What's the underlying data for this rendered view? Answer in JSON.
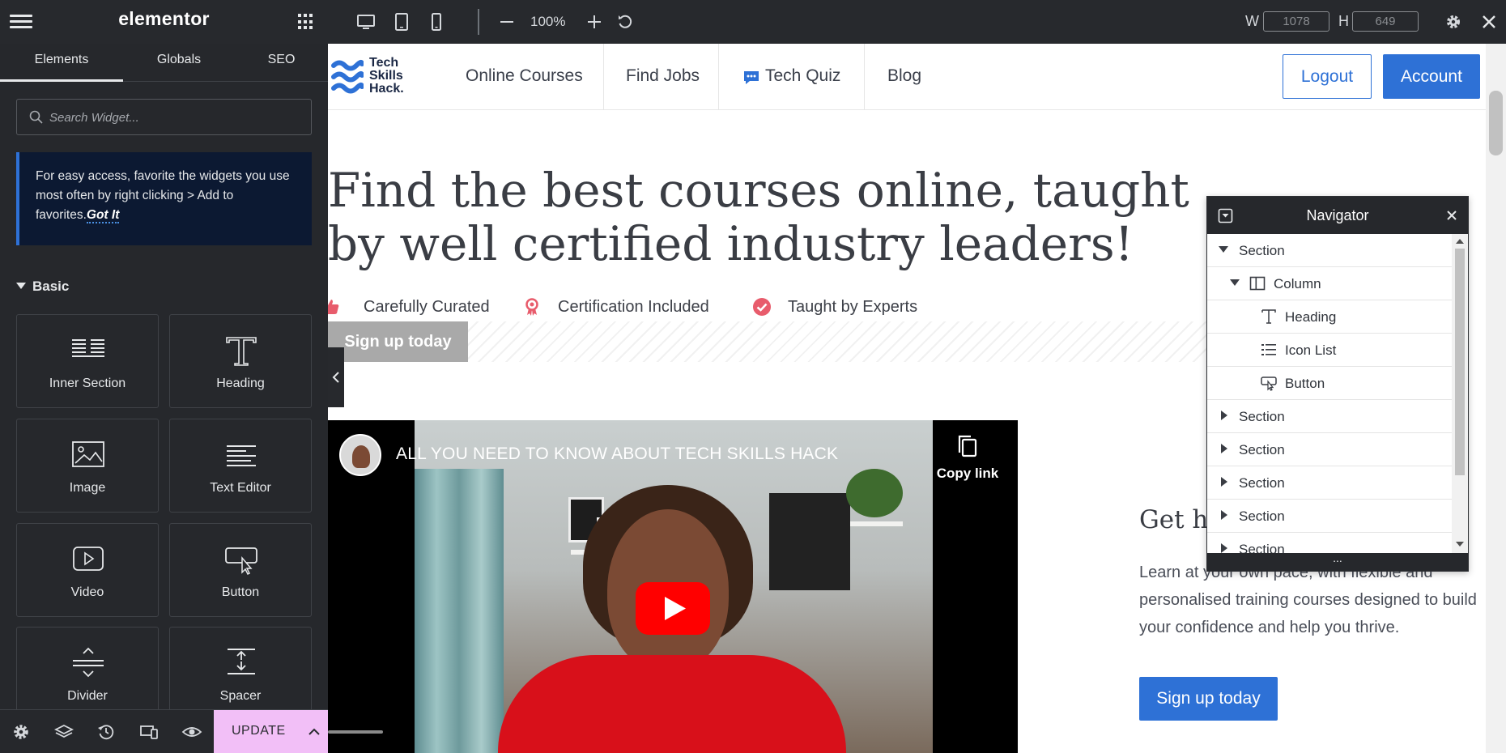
{
  "topbar": {
    "logo": "elementor",
    "zoom": "100%",
    "width_label": "W",
    "width_value": "1078",
    "height_label": "H",
    "height_value": "649"
  },
  "panel": {
    "tabs": [
      {
        "label": "Elements",
        "active": true
      },
      {
        "label": "Globals",
        "active": false
      },
      {
        "label": "SEO",
        "active": false
      }
    ],
    "search": {
      "placeholder": "Search Widget..."
    },
    "notice": {
      "text": "For easy access, favorite the widgets you use most often by right clicking > Add to favorites.",
      "link": "Got It"
    },
    "category": "Basic",
    "widgets": [
      {
        "label": "Inner Section",
        "icon": "inner-section-icon"
      },
      {
        "label": "Heading",
        "icon": "heading-icon"
      },
      {
        "label": "Image",
        "icon": "image-icon"
      },
      {
        "label": "Text Editor",
        "icon": "text-editor-icon"
      },
      {
        "label": "Video",
        "icon": "video-icon"
      },
      {
        "label": "Button",
        "icon": "button-icon"
      },
      {
        "label": "Divider",
        "icon": "divider-icon"
      },
      {
        "label": "Spacer",
        "icon": "spacer-icon"
      }
    ],
    "footer": {
      "update_label": "UPDATE"
    }
  },
  "site": {
    "logo_lines": [
      "Tech",
      "Skills",
      "Hack."
    ],
    "nav": [
      "Online Courses",
      "Find Jobs",
      "Tech Quiz",
      "Blog"
    ],
    "logout": "Logout",
    "account": "Account",
    "hero_title": "Find the best courses online, taught by well certified industry leaders!",
    "features": [
      "Carefully Curated",
      "Certification Included",
      "Taught by Experts"
    ],
    "signup": "Sign up today",
    "video": {
      "title": "ALL YOU NEED TO KNOW ABOUT TECH SKILLS HACK",
      "copy_link": "Copy link"
    },
    "side_heading": "Get hi",
    "side_text": "Learn at your own pace, with flexible and personalised training courses designed to build your confidence and help you thrive.",
    "side_signup": "Sign up today"
  },
  "navigator": {
    "title": "Navigator",
    "items": [
      {
        "label": "Section",
        "level": 0,
        "expanded": true
      },
      {
        "label": "Column",
        "level": 1,
        "expanded": true
      },
      {
        "label": "Heading",
        "level": 2
      },
      {
        "label": "Icon List",
        "level": 2
      },
      {
        "label": "Button",
        "level": 2
      },
      {
        "label": "Section",
        "level": 0,
        "expanded": false
      },
      {
        "label": "Section",
        "level": 0,
        "expanded": false
      },
      {
        "label": "Section",
        "level": 0,
        "expanded": false
      },
      {
        "label": "Section",
        "level": 0,
        "expanded": false
      },
      {
        "label": "Section",
        "level": 0,
        "expanded": false
      }
    ],
    "footer": "..."
  },
  "colors": {
    "editor_dark": "#27292d",
    "accent_blue": "#2e71d6",
    "update_pink": "#f2bff7",
    "notice_bg": "#0c1932",
    "feature_red": "#e85c6c"
  }
}
